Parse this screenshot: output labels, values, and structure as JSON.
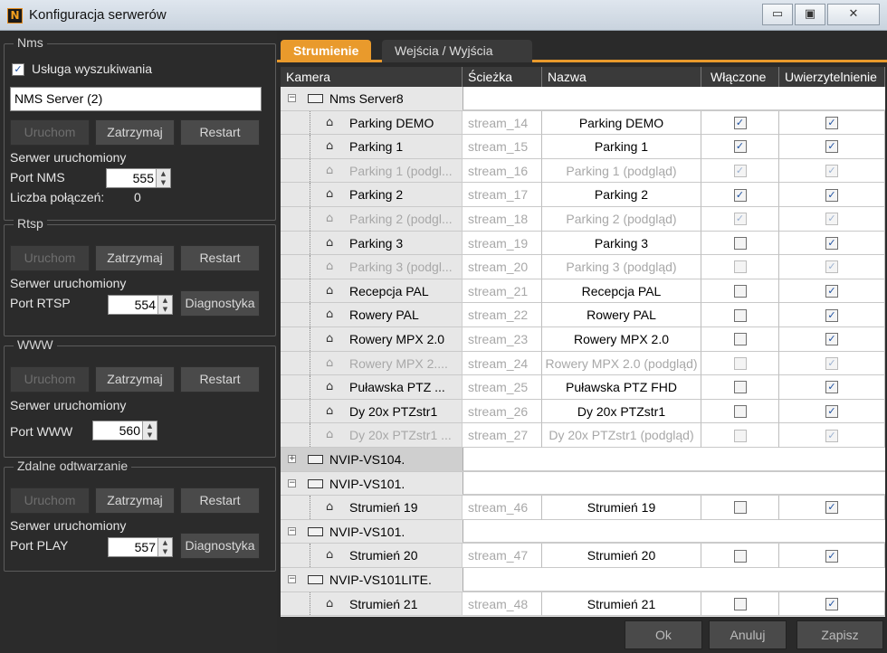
{
  "window": {
    "title": "Konfiguracja serwerów",
    "minimize": "▭",
    "maximize": "▣",
    "close": "✕"
  },
  "left": {
    "nms": {
      "title": "Nms",
      "search_label": "Usługa wyszukiwania",
      "search_checked": true,
      "server_field": "NMS Server (2)",
      "start": "Uruchom",
      "stop": "Zatrzymaj",
      "restart": "Restart",
      "status": "Serwer uruchomiony",
      "port_label": "Port NMS",
      "port_value": "555",
      "conn_label": "Liczba połączeń:",
      "conn_value": "0"
    },
    "rtsp": {
      "title": "Rtsp",
      "start": "Uruchom",
      "stop": "Zatrzymaj",
      "restart": "Restart",
      "status": "Serwer uruchomiony",
      "port_label": "Port RTSP",
      "port_value": "554",
      "diag": "Diagnostyka"
    },
    "www": {
      "title": "WWW",
      "start": "Uruchom",
      "stop": "Zatrzymaj",
      "restart": "Restart",
      "status": "Serwer uruchomiony",
      "port_label": "Port WWW",
      "port_value": "560"
    },
    "play": {
      "title": "Zdalne odtwarzanie",
      "start": "Uruchom",
      "stop": "Zatrzymaj",
      "restart": "Restart",
      "status": "Serwer uruchomiony",
      "port_label": "Port PLAY",
      "port_value": "557",
      "diag": "Diagnostyka"
    }
  },
  "tabs": [
    {
      "label": "Strumienie",
      "active": true
    },
    {
      "label": "Wejścia / Wyjścia",
      "active": false
    }
  ],
  "columns": [
    "Kamera",
    "Ścieżka",
    "Nazwa",
    "Włączone",
    "Uwierzytelnienie"
  ],
  "rows": [
    {
      "type": "server",
      "name": "Nms Server8",
      "expanded": true
    },
    {
      "type": "stream",
      "camera": "Parking DEMO",
      "path": "stream_14",
      "name": "Parking DEMO",
      "enabled": true,
      "auth": true,
      "grey": false
    },
    {
      "type": "stream",
      "camera": "Parking 1",
      "path": "stream_15",
      "name": "Parking 1",
      "enabled": true,
      "auth": true,
      "grey": false
    },
    {
      "type": "stream",
      "camera": "Parking 1 (podgl...",
      "path": "stream_16",
      "name": "Parking 1 (podgląd)",
      "enabled": true,
      "auth": true,
      "grey": true
    },
    {
      "type": "stream",
      "camera": "Parking 2",
      "path": "stream_17",
      "name": "Parking 2",
      "enabled": true,
      "auth": true,
      "grey": false
    },
    {
      "type": "stream",
      "camera": "Parking 2 (podgl...",
      "path": "stream_18",
      "name": "Parking 2 (podgląd)",
      "enabled": true,
      "auth": true,
      "grey": true
    },
    {
      "type": "stream",
      "camera": "Parking 3",
      "path": "stream_19",
      "name": "Parking 3",
      "enabled": false,
      "auth": true,
      "grey": false
    },
    {
      "type": "stream",
      "camera": "Parking 3 (podgl...",
      "path": "stream_20",
      "name": "Parking 3 (podgląd)",
      "enabled": false,
      "auth": true,
      "grey": true
    },
    {
      "type": "stream",
      "camera": "Recepcja PAL",
      "path": "stream_21",
      "name": "Recepcja PAL",
      "enabled": false,
      "auth": true,
      "grey": false
    },
    {
      "type": "stream",
      "camera": "Rowery PAL",
      "path": "stream_22",
      "name": "Rowery PAL",
      "enabled": false,
      "auth": true,
      "grey": false
    },
    {
      "type": "stream",
      "camera": "Rowery MPX 2.0",
      "path": "stream_23",
      "name": "Rowery MPX 2.0",
      "enabled": false,
      "auth": true,
      "grey": false
    },
    {
      "type": "stream",
      "camera": "Rowery MPX 2....",
      "path": "stream_24",
      "name": "Rowery MPX 2.0 (podgląd)",
      "enabled": false,
      "auth": true,
      "grey": true
    },
    {
      "type": "stream",
      "camera": "Puławska PTZ ...",
      "path": "stream_25",
      "name": "Puławska PTZ FHD",
      "enabled": false,
      "auth": true,
      "grey": false
    },
    {
      "type": "stream",
      "camera": "Dy 20x PTZstr1",
      "path": "stream_26",
      "name": "Dy 20x PTZstr1",
      "enabled": false,
      "auth": true,
      "grey": false
    },
    {
      "type": "stream",
      "camera": "Dy 20x PTZstr1 ...",
      "path": "stream_27",
      "name": "Dy 20x PTZstr1 (podgląd)",
      "enabled": false,
      "auth": true,
      "grey": true
    },
    {
      "type": "server",
      "name": "NVIP-VS104.",
      "expanded": false,
      "selected": true
    },
    {
      "type": "server",
      "name": "NVIP-VS101.",
      "expanded": true
    },
    {
      "type": "stream",
      "camera": "Strumień 19",
      "path": "stream_46",
      "name": "Strumień 19",
      "enabled": false,
      "auth": true,
      "grey": false
    },
    {
      "type": "server",
      "name": "NVIP-VS101.",
      "expanded": true
    },
    {
      "type": "stream",
      "camera": "Strumień 20",
      "path": "stream_47",
      "name": "Strumień 20",
      "enabled": false,
      "auth": true,
      "grey": false
    },
    {
      "type": "server",
      "name": "NVIP-VS101LITE.",
      "expanded": true
    },
    {
      "type": "stream",
      "camera": "Strumień 21",
      "path": "stream_48",
      "name": "Strumień 21",
      "enabled": false,
      "auth": true,
      "grey": false
    }
  ],
  "footer": {
    "ok": "Ok",
    "cancel": "Anuluj",
    "save": "Zapisz"
  },
  "colors": {
    "accent": "#e99a2c",
    "background": "#2a2a2a"
  }
}
